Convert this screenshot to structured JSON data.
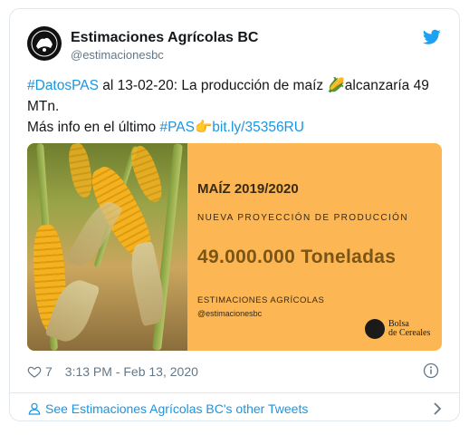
{
  "author": {
    "name": "Estimaciones Agrícolas BC",
    "handle": "@estimacionesbc",
    "avatar_icon": "bolsa-de-cereales-logo"
  },
  "tweet": {
    "hashtag1": "#DatosPAS",
    "text_part1": " al 13-02-20: La producción de maíz ",
    "corn_emoji": "🌽",
    "text_part2": "alcanzaría 49 MTn.",
    "text_part3": "Más info en el último ",
    "hashtag2": "#PAS",
    "pointing_emoji": "👉",
    "link": "bit.ly/35356RU"
  },
  "media": {
    "title": "MAÍZ 2019/2020",
    "subtitle": "NUEVA PROYECCIÓN DE PRODUCCIÓN",
    "figure": "49.000.000 Toneladas",
    "org": "ESTIMACIONES AGRÍCOLAS",
    "handle": "@estimacionesbc",
    "logo_line1": "Bolsa",
    "logo_line2": "de Cereales",
    "background_color": "#fcb653"
  },
  "meta": {
    "like_count": "7",
    "timestamp": "3:13 PM - Feb 13, 2020"
  },
  "footer": {
    "link_text": "See Estimaciones Agrícolas BC's other Tweets"
  },
  "colors": {
    "link": "#1b95e0",
    "twitter_blue": "#1da1f2",
    "muted": "#657786"
  }
}
